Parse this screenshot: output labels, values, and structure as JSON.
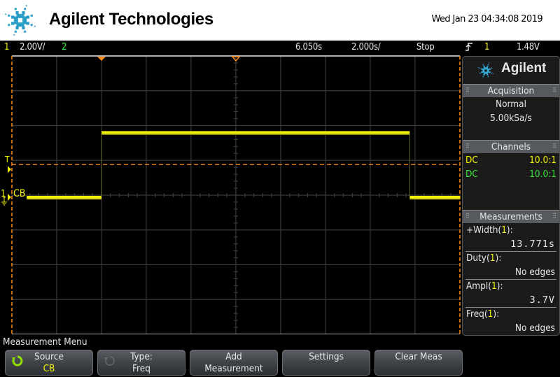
{
  "header": {
    "brand": "Agilent Technologies",
    "datetime": "Wed Jan 23 04:34:08 2019"
  },
  "status_bar": {
    "channel1_number": "1",
    "channel1_scale": "2.00V/",
    "channel2_number": "2",
    "time_delay": "6.050s",
    "time_scale": "2.000s/",
    "run_state": "Stop",
    "trigger_slope_icon": "rising-edge-icon",
    "trigger_source": "1",
    "trigger_level": "1.48V"
  },
  "screen": {
    "trigger_marker_label": "T",
    "channel1_marker_label": "1",
    "channel1_name": "CB",
    "colors": {
      "channel1": "#f2f20a",
      "channel2": "#36e636",
      "cursor": "#ff8c1a",
      "grid": "#3a3a3a"
    },
    "waveform": {
      "channel": "1",
      "low_level_div": -0.06,
      "high_level_div": 1.8,
      "segments": [
        {
          "from_div": -4.67,
          "to_div": -3.0,
          "level": "low"
        },
        {
          "from_div": -3.0,
          "to_div": 3.88,
          "level": "high"
        },
        {
          "from_div": 3.88,
          "to_div": 5.0,
          "level": "low"
        }
      ],
      "trigger_level_div": 0.88
    }
  },
  "side_panel": {
    "brand": "Agilent",
    "acquisition": {
      "title": "Acquisition",
      "mode": "Normal",
      "sample_rate": "5.00kSa/s"
    },
    "channels": {
      "title": "Channels",
      "rows": [
        {
          "coupling": "DC",
          "probe": "10.0:1",
          "color": "#f2f20a"
        },
        {
          "coupling": "DC",
          "probe": "10.0:1",
          "color": "#36e636"
        }
      ]
    },
    "measurements": {
      "title": "Measurements",
      "items": [
        {
          "name": "+Width(",
          "src": "1",
          "close": "):",
          "value": "13.771s",
          "mono": true
        },
        {
          "name": "Duty(",
          "src": "1",
          "close": "):",
          "value": "No edges",
          "mono": false
        },
        {
          "name": "Ampl(",
          "src": "1",
          "close": "):",
          "value": "3.7V",
          "mono": true
        },
        {
          "name": "Freq(",
          "src": "1",
          "close": "):",
          "value": "No edges",
          "mono": false
        }
      ]
    }
  },
  "menu": {
    "title": "Measurement Menu",
    "softkeys": [
      {
        "line1": "Source",
        "line2": "CB",
        "icon": "entry-knob-icon",
        "active": true
      },
      {
        "line1": "Type:",
        "line2": "Freq",
        "icon": "entry-knob-icon",
        "active": false
      },
      {
        "line1": "Add",
        "line2": "Measurement"
      },
      {
        "line1": "Settings",
        "icon": "down-arrow-icon"
      },
      {
        "line1": "Clear Meas",
        "icon": "down-arrow-icon"
      }
    ]
  }
}
